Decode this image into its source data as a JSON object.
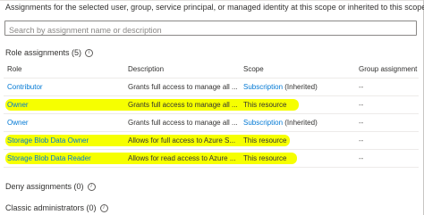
{
  "intro_text": "Assignments for the selected user, group, service principal, or managed identity at this scope or inherited to this scope.",
  "search": {
    "placeholder": "Search by assignment name or description"
  },
  "role_assignments": {
    "title": "Role assignments (5)",
    "columns": [
      "Role",
      "Description",
      "Scope",
      "Group assignment"
    ],
    "rows": [
      {
        "role": "Contributor",
        "description": "Grants full access to manage all ...",
        "scope_link": "Subscription",
        "scope_suffix": "(Inherited)",
        "group": "--"
      },
      {
        "role": "Owner",
        "description": "Grants full access to manage all ...",
        "scope_text": "This resource",
        "group": "--"
      },
      {
        "role": "Owner",
        "description": "Grants full access to manage all ...",
        "scope_link": "Subscription",
        "scope_suffix": "(Inherited)",
        "group": "--"
      },
      {
        "role": "Storage Blob Data Owner",
        "description": "Allows for full access to Azure S...",
        "scope_text": "This resource",
        "group": "--"
      },
      {
        "role": "Storage Blob Data Reader",
        "description": "Allows for read access to Azure ...",
        "scope_text": "This resource",
        "group": "--"
      }
    ]
  },
  "deny_assignments": {
    "title": "Deny assignments (0)"
  },
  "classic_administrators": {
    "title": "Classic administrators (0)"
  },
  "colors": {
    "link": "#0078d4",
    "highlight": "#f6ff00"
  }
}
